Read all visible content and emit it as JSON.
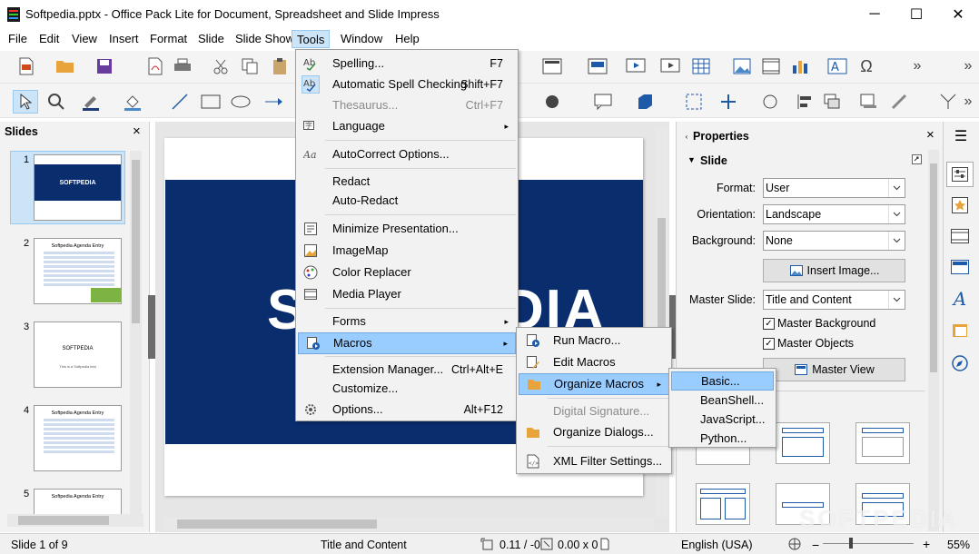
{
  "window": {
    "title": "Softpedia.pptx - Office Pack Lite for Document, Spreadsheet and Slide Impress",
    "minimize": "─",
    "maximize": "☐",
    "close": "✕"
  },
  "menubar": [
    "File",
    "Edit",
    "View",
    "Insert",
    "Format",
    "Slide",
    "Slide Show",
    "Tools",
    "Window",
    "Help"
  ],
  "slides_pane": {
    "title": "Slides",
    "close": "×",
    "thumbs": [
      {
        "num": "1",
        "text": "SOFTPEDIA"
      },
      {
        "num": "2",
        "text": "Softpedia Agenda Entry"
      },
      {
        "num": "3",
        "text": "SOFTPEDIA",
        "sub": "This is a Softpedia test"
      },
      {
        "num": "4",
        "text": "Softpedia Agenda Entry"
      },
      {
        "num": "5",
        "text": "Softpedia Agenda Entry"
      }
    ]
  },
  "slide_text": "SOFTPEDIA",
  "properties": {
    "title": "Properties",
    "close": "×",
    "section": "Slide",
    "format_label": "Format:",
    "format_value": "User",
    "orientation_label": "Orientation:",
    "orientation_value": "Landscape",
    "background_label": "Background:",
    "background_value": "None",
    "insert_image": "Insert Image...",
    "master_slide_label": "Master Slide:",
    "master_slide_value": "Title and Content",
    "master_background": "Master Background",
    "master_objects": "Master Objects",
    "master_view": "Master View"
  },
  "tools_menu": [
    {
      "label": "Spelling...",
      "shortcut": "F7",
      "icon": "spelling-icon"
    },
    {
      "label": "Automatic Spell Checking",
      "shortcut": "Shift+F7",
      "icon": "auto-spell-icon"
    },
    {
      "label": "Thesaurus...",
      "shortcut": "Ctrl+F7",
      "disabled": true
    },
    {
      "label": "Language",
      "submenu": true,
      "icon": "language-icon"
    },
    {
      "label": "AutoCorrect Options...",
      "icon": "autocorrect-icon"
    },
    {
      "label": "Redact"
    },
    {
      "label": "Auto-Redact"
    },
    {
      "label": "Minimize Presentation...",
      "icon": "minimize-presentation-icon"
    },
    {
      "label": "ImageMap",
      "icon": "imagemap-icon"
    },
    {
      "label": "Color Replacer",
      "icon": "color-replacer-icon"
    },
    {
      "label": "Media Player",
      "icon": "media-player-icon"
    },
    {
      "label": "Forms",
      "submenu": true
    },
    {
      "label": "Macros",
      "submenu": true,
      "icon": "macros-icon",
      "highlight": true
    },
    {
      "label": "Extension Manager...",
      "shortcut": "Ctrl+Alt+E"
    },
    {
      "label": "Customize..."
    },
    {
      "label": "Options...",
      "shortcut": "Alt+F12",
      "icon": "options-icon"
    }
  ],
  "macros_menu": [
    {
      "label": "Run Macro...",
      "icon": "run-macro-icon"
    },
    {
      "label": "Edit Macros",
      "icon": "edit-macros-icon"
    },
    {
      "label": "Organize Macros",
      "submenu": true,
      "highlight": true,
      "icon": "organize-macros-icon"
    },
    {
      "label": "Digital Signature...",
      "disabled": true
    },
    {
      "label": "Organize Dialogs...",
      "icon": "organize-dialogs-icon"
    },
    {
      "label": "XML Filter Settings...",
      "icon": "xml-filter-icon"
    }
  ],
  "organize_menu": [
    {
      "label": "Basic...",
      "highlight": true
    },
    {
      "label": "BeanShell..."
    },
    {
      "label": "JavaScript..."
    },
    {
      "label": "Python..."
    }
  ],
  "statusbar": {
    "slide": "Slide 1 of 9",
    "layout": "Title and Content",
    "position": "0.11 / -0",
    "size": "0.00 x 0",
    "language": "English (USA)",
    "zoom": "55%"
  },
  "watermark": "SOFTPEDIA"
}
